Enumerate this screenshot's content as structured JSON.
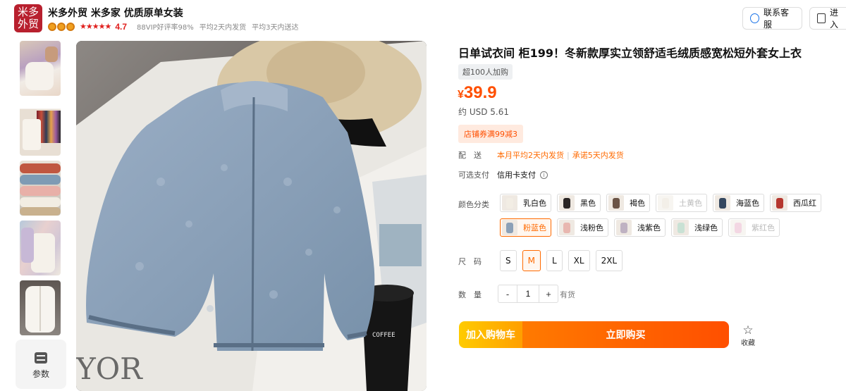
{
  "shop": {
    "logo_text": "米多外贸",
    "name": "米多外贸 米多家 优质原单女装",
    "rating": "4.7",
    "stats": [
      "88VIP好评率98%",
      "平均2天内发货",
      "平均3天内送达"
    ]
  },
  "header": {
    "service_label": "联系客服",
    "enter_shop_label": "进入"
  },
  "gallery": {
    "params_label": "参数"
  },
  "product": {
    "title": "日单试衣间 柜199！冬新款厚实立领舒适毛绒质感宽松短外套女上衣",
    "sold_tag": "超100人加购",
    "price_currency": "¥",
    "price_value": "39.9",
    "usd_price": "约 USD 5.61",
    "coupon": "店铺券满99减3"
  },
  "shipping": {
    "label": "配　送",
    "info_1": "本月平均2天内发货",
    "info_2": "承诺5天内发货"
  },
  "payment": {
    "label": "可选支付",
    "method": "信用卡支付"
  },
  "color_section": {
    "label": "颜色分类",
    "options": [
      {
        "name": "乳白色",
        "swatch": "#f2ede4",
        "state": "normal"
      },
      {
        "name": "黑色",
        "swatch": "#2a2524",
        "state": "normal"
      },
      {
        "name": "褐色",
        "swatch": "#6b5446",
        "state": "normal"
      },
      {
        "name": "土黄色",
        "swatch": "#e6dccd",
        "state": "disabled"
      },
      {
        "name": "海蓝色",
        "swatch": "#34475f",
        "state": "normal"
      },
      {
        "name": "西瓜红",
        "swatch": "#b5372f",
        "state": "normal"
      },
      {
        "name": "粉蓝色",
        "swatch": "#8ba0b7",
        "state": "selected"
      },
      {
        "name": "浅粉色",
        "swatch": "#e8b7b0",
        "state": "normal"
      },
      {
        "name": "浅紫色",
        "swatch": "#bfb2c2",
        "state": "normal"
      },
      {
        "name": "浅绿色",
        "swatch": "#c9e1d4",
        "state": "normal"
      },
      {
        "name": "紫红色",
        "swatch": "#e6a8c2",
        "state": "disabled"
      }
    ]
  },
  "size_section": {
    "label": "尺　码",
    "options": [
      "S",
      "M",
      "L",
      "XL",
      "2XL"
    ],
    "selected": "M"
  },
  "quantity_section": {
    "label": "数　量",
    "minus": "-",
    "value": "1",
    "plus": "+",
    "stock": "有货"
  },
  "actions": {
    "add_to_cart": "加入购物车",
    "buy_now": "立即购买",
    "favorite": "收藏"
  }
}
